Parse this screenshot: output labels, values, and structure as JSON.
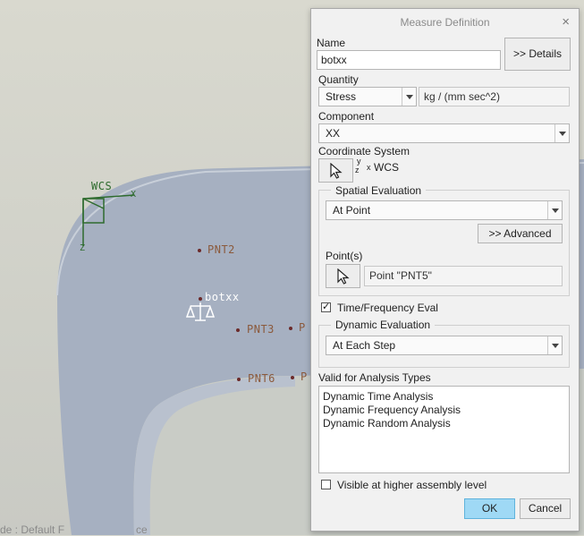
{
  "viewport": {
    "wcs_label": "WCS",
    "axis_x": "X",
    "axis_z": "Z",
    "points": [
      {
        "label": "PNT2"
      },
      {
        "label": "PNT3"
      },
      {
        "label": "PNT6"
      },
      {
        "label": "P"
      },
      {
        "label": "P"
      }
    ],
    "measure_tag": "botxx",
    "status_text": "de : Default F",
    "status_text_tail": "ce"
  },
  "dialog": {
    "title": "Measure Definition",
    "close": "×",
    "name_label": "Name",
    "name_value": "botxx",
    "details_button": ">> Details",
    "quantity_label": "Quantity",
    "quantity_value": "Stress",
    "quantity_units": "kg / (mm sec^2)",
    "component_label": "Component",
    "component_value": "XX",
    "coord_label": "Coordinate System",
    "coord_axis_y": "y",
    "coord_axis_z": "z",
    "coord_axis_x": "x",
    "coord_value": "WCS",
    "spatial_label": "Spatial Evaluation",
    "spatial_value": "At Point",
    "advanced_button": ">> Advanced",
    "points_label": "Point(s)",
    "points_value": "Point \"PNT5\"",
    "time_freq_label": "Time/Frequency Eval",
    "time_freq_checked": true,
    "dynamic_label": "Dynamic Evaluation",
    "dynamic_value": "At Each Step",
    "valid_label": "Valid for Analysis Types",
    "valid_items": [
      "Dynamic Time Analysis",
      "Dynamic Frequency Analysis",
      "Dynamic Random Analysis"
    ],
    "visible_label": "Visible at higher assembly level",
    "visible_checked": false,
    "ok_button": "OK",
    "cancel_button": "Cancel"
  },
  "colors": {
    "ok_button": "#9fd9f5",
    "part_surface": "#a9b3c4",
    "wcs_green": "#2e6b2e",
    "point_label": "#8b5a3c"
  }
}
